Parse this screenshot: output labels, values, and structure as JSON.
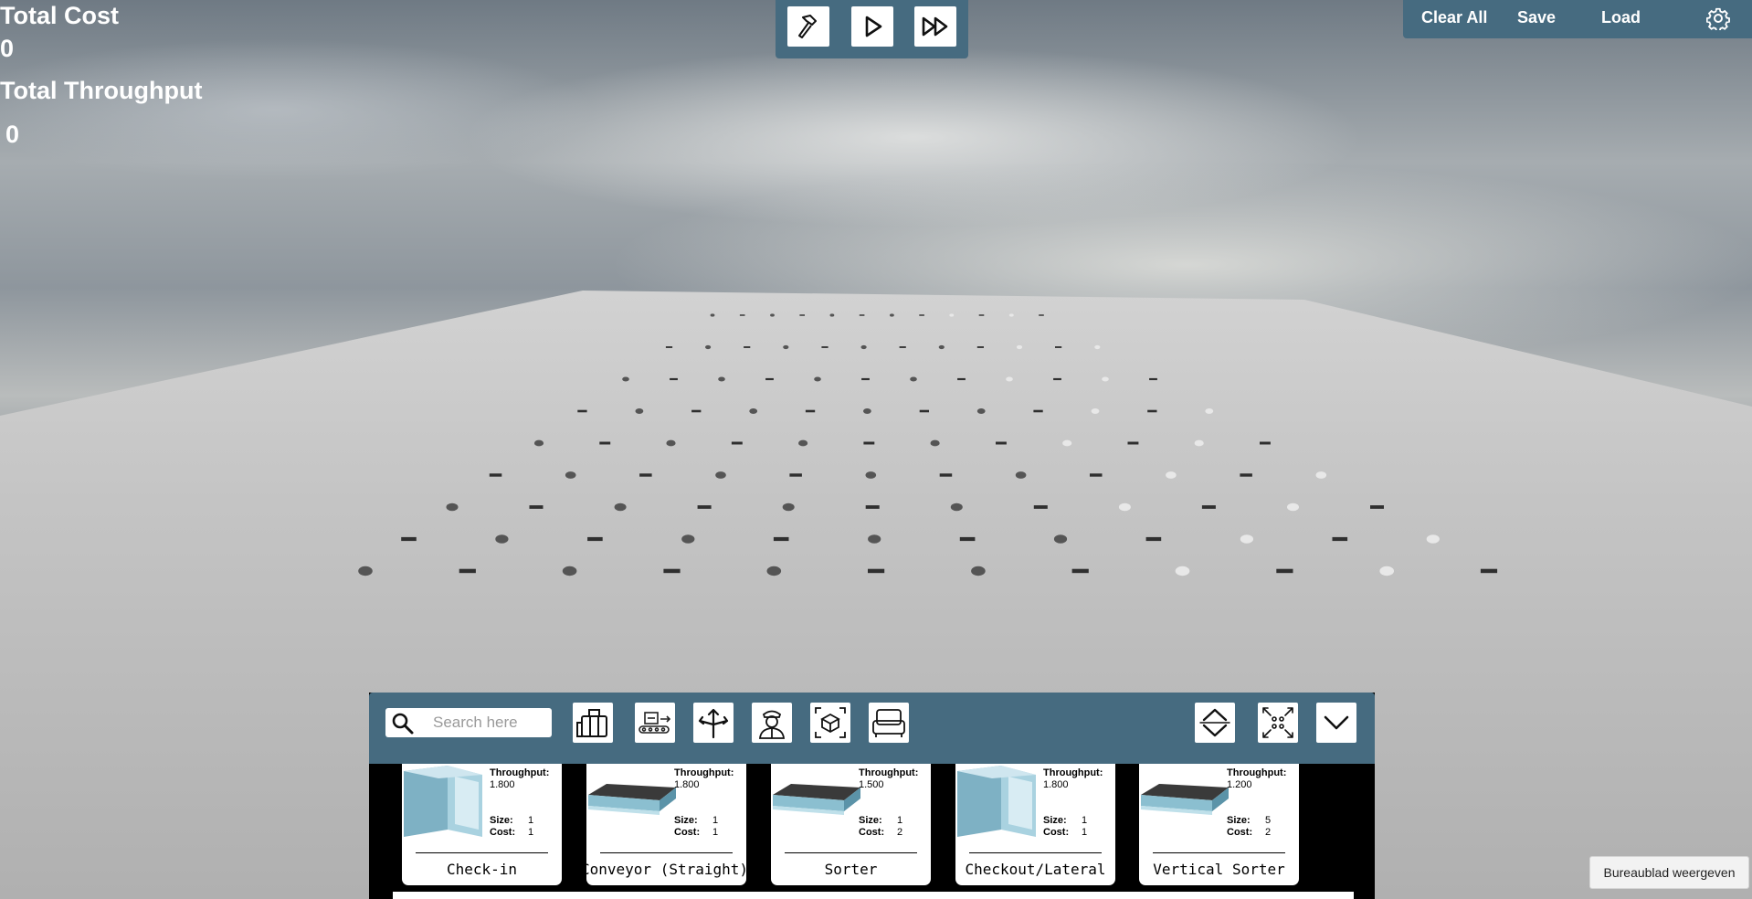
{
  "hud": {
    "total_cost_label": "Total Cost",
    "total_cost_value": "0",
    "total_throughput_label": "Total Throughput",
    "total_throughput_value": "0"
  },
  "playback": {
    "build_icon": "hammer-icon",
    "play_icon": "play-icon",
    "fast_forward_icon": "fast-forward-icon"
  },
  "top_toolbar": {
    "clear_all": "Clear All",
    "save": "Save",
    "load": "Load",
    "settings_icon": "gear-icon"
  },
  "build_panel": {
    "search_placeholder": "Search here",
    "categories": [
      "luggage-icon",
      "conveyor-icon",
      "split-arrows-icon",
      "staff-icon",
      "scan-box-icon",
      "carousel-icon"
    ],
    "controls": [
      "collapse-expand-icon",
      "fit-view-icon",
      "chevron-down-icon"
    ],
    "throughput_label": "Throughput:",
    "size_label": "Size:",
    "cost_label": "Cost:",
    "items": [
      {
        "name": "Check-in",
        "throughput": "1.800",
        "size": "1",
        "cost": "1",
        "shape": "box"
      },
      {
        "name": "Conveyor (Straight)",
        "throughput": "1.800",
        "size": "1",
        "cost": "1",
        "shape": "belt"
      },
      {
        "name": "Sorter",
        "throughput": "1.500",
        "size": "1",
        "cost": "2",
        "shape": "belt"
      },
      {
        "name": "Checkout/Lateral",
        "throughput": "1.800",
        "size": "1",
        "cost": "1",
        "shape": "box"
      },
      {
        "name": "Vertical Sorter",
        "throughput": "1.200",
        "size": "5",
        "cost": "2",
        "shape": "belt"
      }
    ]
  },
  "desktop_tooltip": "Bureaublad weergeven",
  "colors": {
    "panel": "#466b80",
    "ground": "#bdbdbd"
  }
}
